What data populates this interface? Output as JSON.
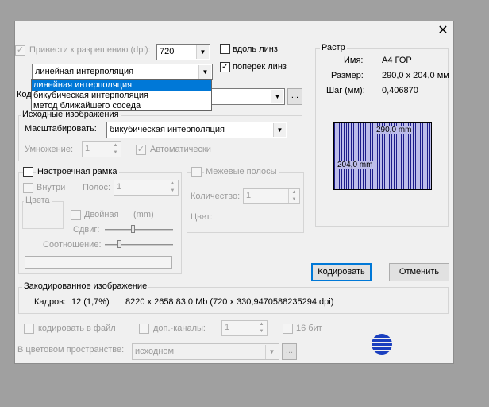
{
  "dialog": {
    "close_glyph": "✕",
    "resolution": {
      "checkbox_label": "Привести к разрешению (dpi):",
      "value": "720"
    },
    "along_lens_label": "вдоль линз",
    "across_lens_label": "поперек линз",
    "interp_combo_value": "линейная интерполяция",
    "interp_options": [
      "линейная интерполяция",
      "бикубическая интерполяция",
      "метод ближайшего соседа"
    ],
    "code_label": "Код",
    "browse_label": "...",
    "source": {
      "title": "Исходные изображения",
      "scale_label": "Масштабировать:",
      "scale_value": "бикубическая интерполяция",
      "multiply_label": "Умножение:",
      "multiply_value": "1",
      "auto_label": "Автоматически"
    },
    "frame": {
      "title": "Настроечная рамка",
      "inside_label": "Внутри",
      "stripes_label": "Полос:",
      "stripes_value": "1",
      "colors_label": "Цвета",
      "double_label": "Двойная",
      "mm_label": "(mm)",
      "shift_label": "Сдвиг:",
      "ratio_label": "Соотношение:"
    },
    "boundary": {
      "title": "Межевые полосы",
      "count_label": "Количество:",
      "count_value": "1",
      "color_label": "Цвет:"
    },
    "raster": {
      "title": "Растр",
      "name_label": "Имя:",
      "name_value": "A4 ГОР",
      "size_label": "Размер:",
      "size_value": "290,0 x 204,0 мм",
      "step_label": "Шаг (мм):",
      "step_value": "0,406870",
      "preview_width": "290,0 mm",
      "preview_height": "204,0 mm"
    },
    "encode_button": "Кодировать",
    "cancel_button": "Отменить",
    "encoded": {
      "title": "Закодированное изображение",
      "frames_label": "Кадров:",
      "frames_value": "12 (1,7%)",
      "details": "8220 x 2658  83,0 Mb (720 x 330,9470588235294 dpi)"
    },
    "bottom": {
      "to_file_label": "кодировать в файл",
      "extra_channels_label": "доп.-каналы:",
      "extra_channels_value": "1",
      "bits16_label": "16 бит",
      "color_space_label": "В цветовом пространстве:",
      "color_space_value": "исходном"
    }
  },
  "colors": {
    "accent": "#0078d7",
    "preview_blue": "#1c1c8a",
    "backdrop": "#a0a0a0"
  },
  "icons": [
    "close-icon",
    "dropdown-arrow-icon",
    "globe-logo-icon",
    "checkmark-icon",
    "spin-up-icon",
    "spin-down-icon"
  ]
}
